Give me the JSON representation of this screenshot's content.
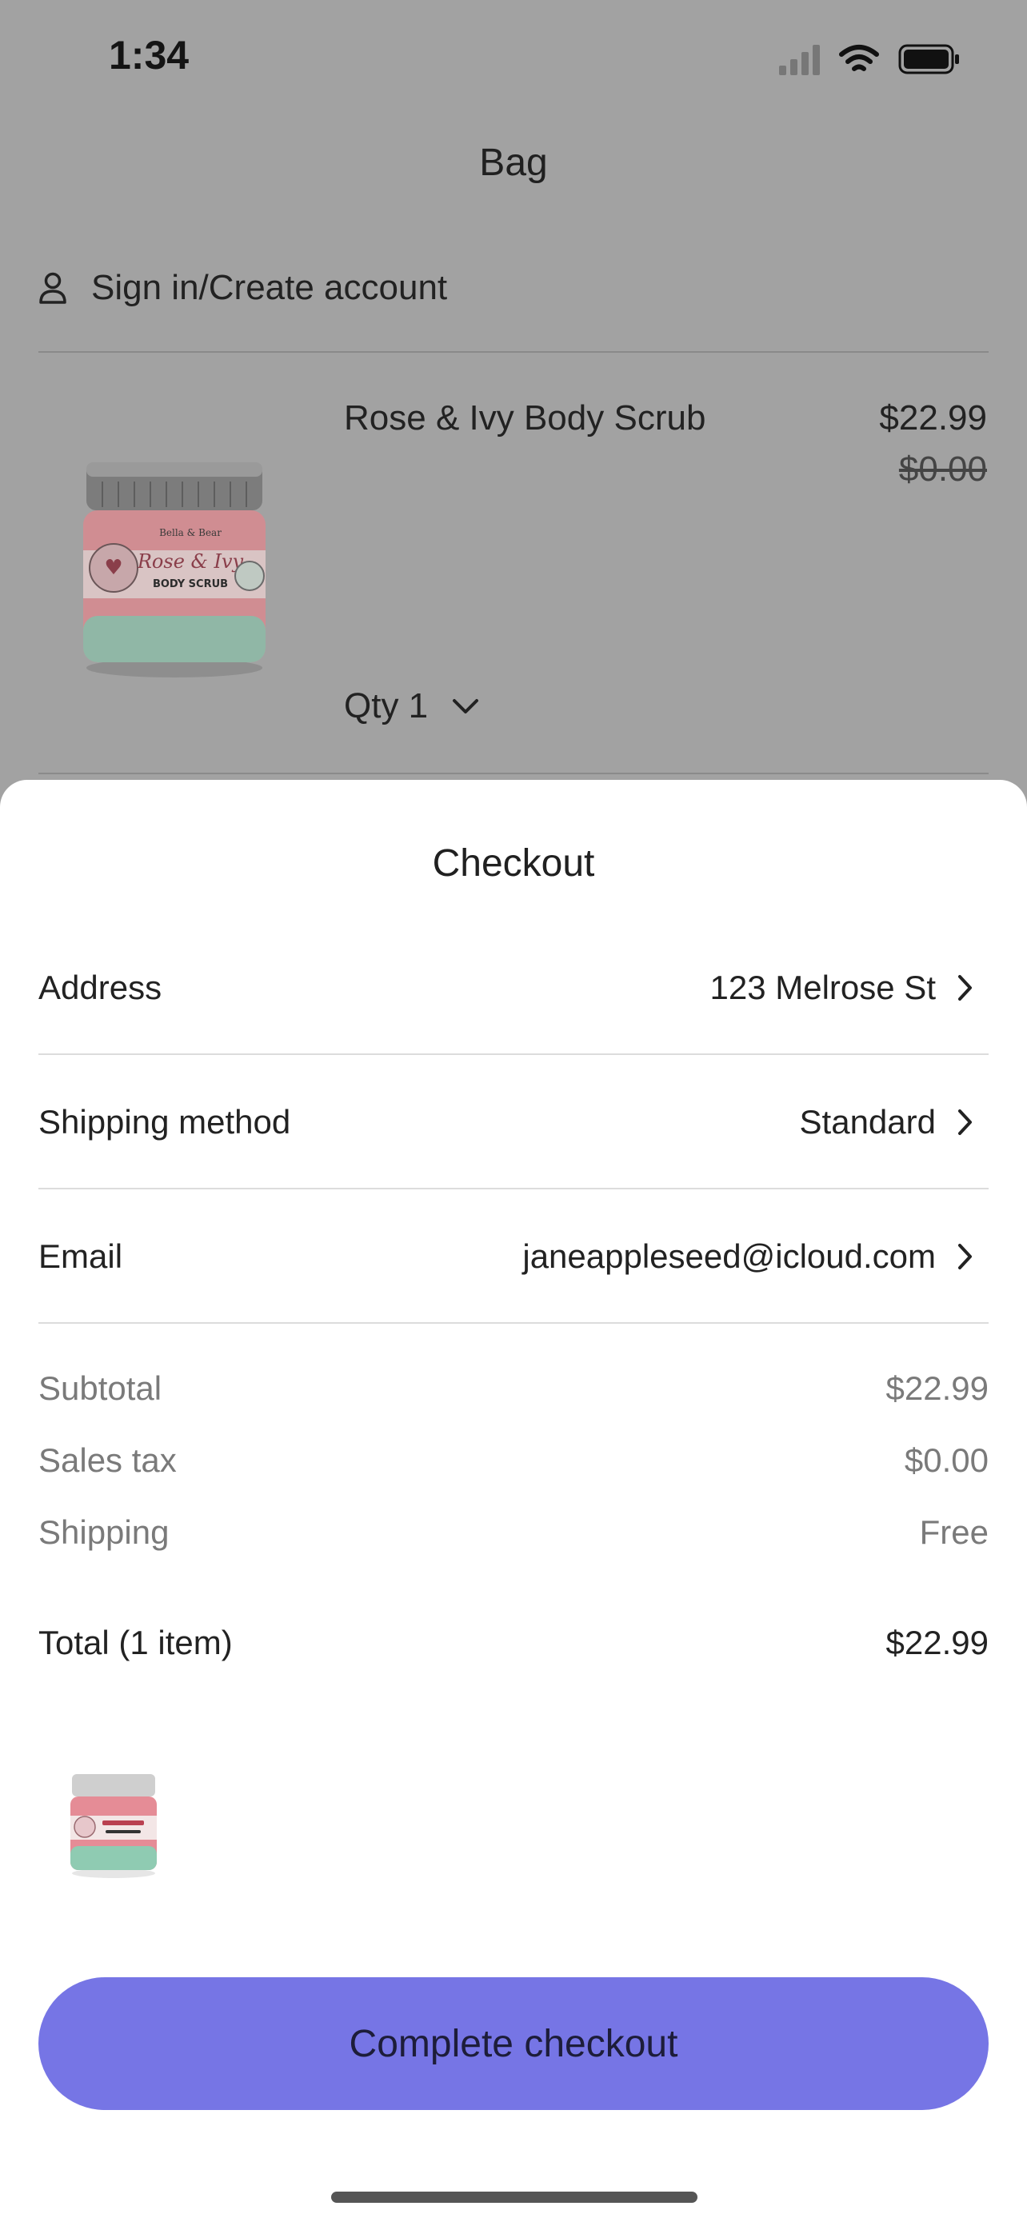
{
  "status": {
    "time": "1:34"
  },
  "bag": {
    "title": "Bag",
    "signin_label": "Sign in/Create account",
    "item": {
      "name": "Rose & Ivy Body Scrub",
      "price": "$22.99",
      "original_price": "$0.00",
      "qty_label": "Qty 1",
      "image_brand": "Bella & Bear",
      "image_line1": "Rose & Ivy",
      "image_line2": "BODY SCRUB"
    }
  },
  "checkout": {
    "title": "Checkout",
    "rows": [
      {
        "label": "Address",
        "value": "123 Melrose St"
      },
      {
        "label": "Shipping method",
        "value": "Standard"
      },
      {
        "label": "Email",
        "value": "janeappleseed@icloud.com"
      }
    ],
    "summary": [
      {
        "label": "Subtotal",
        "value": "$22.99"
      },
      {
        "label": "Sales tax",
        "value": "$0.00"
      },
      {
        "label": "Shipping",
        "value": "Free"
      }
    ],
    "total": {
      "label": "Total (1 item)",
      "value": "$22.99"
    },
    "cta_label": "Complete checkout"
  },
  "colors": {
    "accent": "#7675e5",
    "overlay": "#a2a2a2",
    "sheet": "#ffffff"
  },
  "icons": [
    "person-icon",
    "chevron-down-icon",
    "chevron-right-icon",
    "signal-icon",
    "wifi-icon",
    "battery-icon"
  ]
}
